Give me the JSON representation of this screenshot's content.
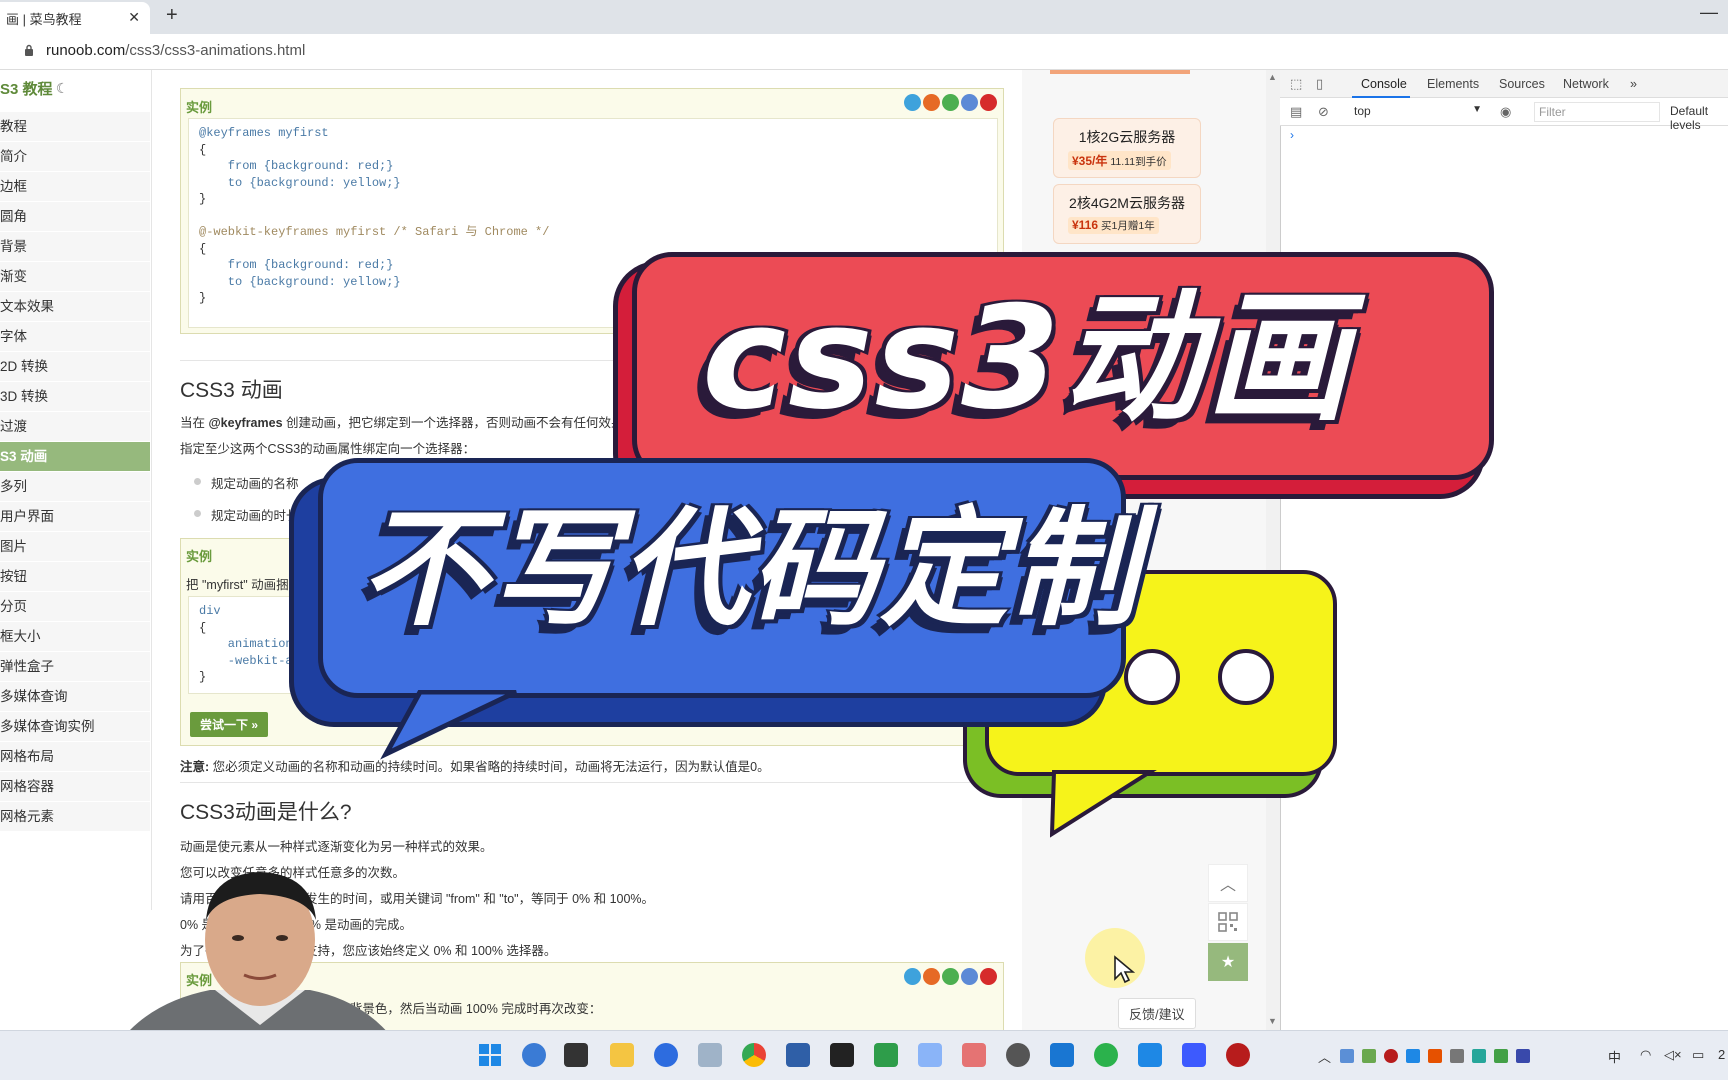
{
  "browser": {
    "tab_title": "画 | 菜鸟教程",
    "tab_close": "✕",
    "new_tab": "+",
    "minimize": "—",
    "url_host": "runoob.com",
    "url_path": "/css3/css3-animations.html"
  },
  "sidebar": {
    "heading": "S3 教程",
    "items": [
      {
        "label": "教程"
      },
      {
        "label": "简介"
      },
      {
        "label": "边框"
      },
      {
        "label": "圆角"
      },
      {
        "label": "背景"
      },
      {
        "label": "渐变"
      },
      {
        "label": "文本效果"
      },
      {
        "label": "字体"
      },
      {
        "label": "2D 转换"
      },
      {
        "label": "3D 转换"
      },
      {
        "label": "过渡"
      },
      {
        "label": "S3 动画",
        "active": true
      },
      {
        "label": "多列"
      },
      {
        "label": "用户界面"
      },
      {
        "label": "图片"
      },
      {
        "label": "按钮"
      },
      {
        "label": "分页"
      },
      {
        "label": "框大小"
      },
      {
        "label": "弹性盒子"
      },
      {
        "label": "多媒体查询"
      },
      {
        "label": "多媒体查询实例"
      },
      {
        "label": "网格布局"
      },
      {
        "label": "网格容器"
      },
      {
        "label": "网格元素"
      }
    ]
  },
  "content": {
    "example_label": "实例",
    "code1": [
      "@keyframes myfirst",
      "{",
      "    from {background: red;}",
      "    to {background: yellow;}",
      "}",
      "",
      "@-webkit-keyframes myfirst /* Safari 与 Chrome */",
      "{",
      "    from {background: red;}",
      "    to {background: yellow;}",
      "}"
    ],
    "section1_title": "CSS3 动画",
    "section1_p1_pre": "当在 ",
    "section1_p1_kw": "@keyframes",
    "section1_p1_post": " 创建动画，把它绑定到一个选择器，否则动画不会有任何效果",
    "section1_p2": "指定至少这两个CSS3的动画属性绑定向一个选择器：",
    "bullets": [
      "规定动画的名称",
      "规定动画的时长"
    ],
    "example2_desc": "把 \"myfirst\" 动画捆",
    "code2": [
      "div",
      "{",
      "    animation",
      "    -webkit-ar",
      "}"
    ],
    "try_button": "尝试一下 »",
    "note_label": "注意:",
    "note_text": " 您必须定义动画的名称和动画的持续时间。如果省略的持续时间，动画将无法运行，因为默认值是0。",
    "section2_title": "CSS3动画是什么?",
    "section2_lines": [
      "动画是使元素从一种样式逐渐变化为另一种样式的效果。",
      "您可以改变任意多的样式任意多的次数。",
      "请用百分比来规定变化发生的时间，或用关键词 \"from\" 和 \"to\"，等同于 0% 和 100%。",
      "0% 是动画的开始，100% 是动画的完成。",
      "为了得到最佳的浏览器支持，您应该始终定义 0% 和 100% 选择器。"
    ],
    "example3_label": "实例",
    "example3_desc": "当动画为 25% 及 50% 时改变背景色，然后当动画 100% 完成时再次改变："
  },
  "ads": [
    {
      "title": "1核2G云服务器",
      "price": "¥35/年",
      "note": "11.11到手价"
    },
    {
      "title": "2核4G2M云服务器",
      "price": "¥116",
      "note": "买1月赠1年"
    }
  ],
  "float_buttons": {
    "feedback": "反馈/建议"
  },
  "devtools": {
    "tabs": [
      "Console",
      "Elements",
      "Sources",
      "Network",
      "»"
    ],
    "context": "top",
    "filter_placeholder": "Filter",
    "levels": "Default levels",
    "prompt": "›"
  },
  "overlay": {
    "title1": "css3动画",
    "title2": "不写代码定制"
  },
  "taskbar": {
    "ime": "中",
    "tray_extra": "2"
  },
  "colors": {
    "accent_green": "#96b97d",
    "overlay_red": "#ec4b55",
    "overlay_blue": "#3f6fe0",
    "overlay_yellow": "#f6f31a"
  }
}
